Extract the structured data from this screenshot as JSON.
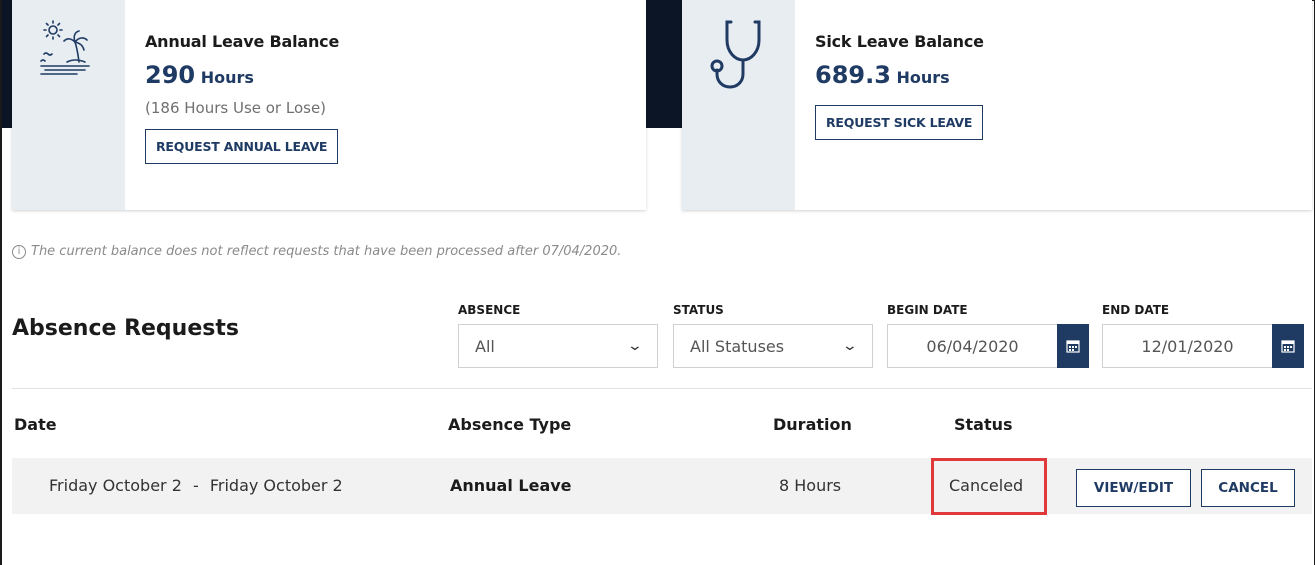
{
  "annual_card": {
    "title": "Annual Leave Balance",
    "balance_value": "290",
    "balance_unit": "Hours",
    "use_or_lose": "(186 Hours Use or Lose)",
    "request_button": "REQUEST ANNUAL LEAVE",
    "icon": "beach-palm-icon"
  },
  "sick_card": {
    "title": "Sick Leave Balance",
    "balance_value": "689.3",
    "balance_unit": "Hours",
    "request_button": "REQUEST SICK LEAVE",
    "icon": "stethoscope-icon"
  },
  "notice": {
    "icon": "info-icon",
    "text": "The current balance does not reflect requests that have been processed after 07/04/2020."
  },
  "absence_requests": {
    "title": "Absence Requests",
    "filters": {
      "absence_label": "ABSENCE",
      "absence_value": "All",
      "status_label": "STATUS",
      "status_value": "All Statuses",
      "begin_label": "BEGIN DATE",
      "begin_value": "06/04/2020",
      "end_label": "END DATE",
      "end_value": "12/01/2020"
    },
    "columns": {
      "date": "Date",
      "absence_type": "Absence Type",
      "duration": "Duration",
      "status": "Status"
    },
    "rows": [
      {
        "date_start": "Friday October 2",
        "date_sep": "-",
        "date_end": "Friday October 2",
        "absence_type": "Annual Leave",
        "duration": "8 Hours",
        "status": "Canceled",
        "view_edit": "VIEW/EDIT",
        "cancel": "CANCEL"
      }
    ]
  },
  "colors": {
    "primary": "#1f3b63",
    "highlight": "#e0393b",
    "icon_bg": "#e8edf2",
    "row_bg": "#f2f2f2"
  }
}
